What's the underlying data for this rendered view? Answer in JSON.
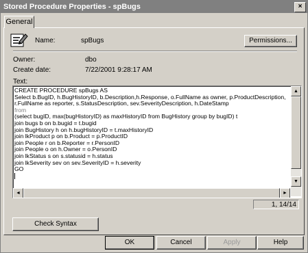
{
  "window": {
    "title": "Stored Procedure Properties - spBugs",
    "close_glyph": "×"
  },
  "tabs": [
    {
      "label": "General"
    }
  ],
  "properties": {
    "name_label": "Name:",
    "name_value": "spBugs",
    "permissions_button": "Permissions...",
    "owner_label": "Owner:",
    "owner_value": "dbo",
    "create_date_label": "Create date:",
    "create_date_value": "7/22/2001 9:28:17 AM",
    "text_label": "Text:"
  },
  "code_lines": [
    "CREATE PROCEDURE spBugs  AS",
    "Select b.BugID, h.BugHistoryID, b.Description,h.Response, o.FullName as owner, p.ProductDescription,",
    "r.FullName as reporter, s.StatusDescription, sev.SeverityDescription, h.DateStamp",
    "from",
    "(select bugID, max(bugHistoryID) as maxHistoryID from BugHistory group by bugID) t",
    "join bugs b on b.bugid = t.bugid",
    "join BugHistory h on h.bugHistoryID = t.maxHistoryID",
    "join lkProduct p on b.Product = p.ProductID",
    "join People r on b.Reporter = r.PersonID",
    "join People o on h.Owner = o.PersonID",
    "join lkStatus s on s.statusid = h.status",
    "join lkSeverity sev on sev.SeverityID = h.severity",
    "GO"
  ],
  "cursor_position": "1, 14/14",
  "scrollbar_glyphs": {
    "up": "▲",
    "down": "▼",
    "left": "◄",
    "right": "►"
  },
  "buttons": {
    "check_syntax": "Check Syntax",
    "ok": "OK",
    "cancel": "Cancel",
    "apply": "Apply",
    "help": "Help"
  }
}
